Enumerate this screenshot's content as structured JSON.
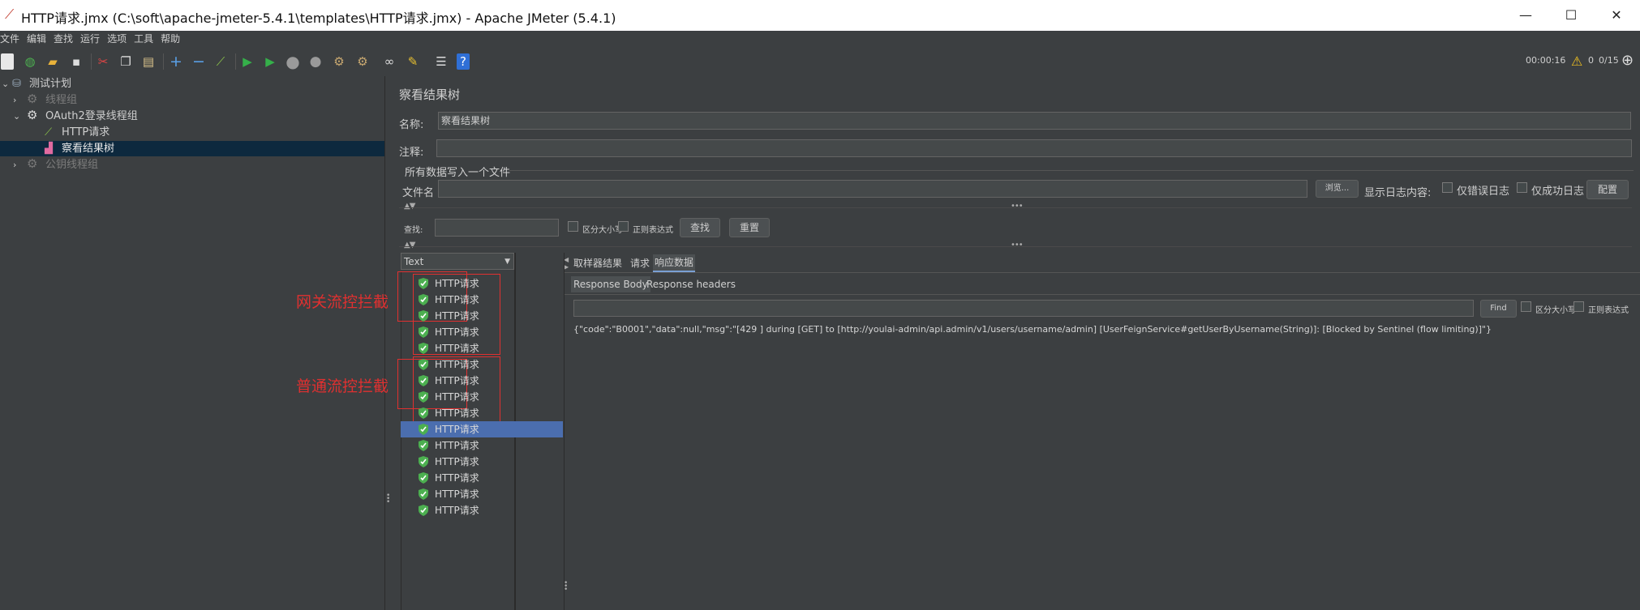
{
  "window": {
    "title": "HTTP请求.jmx (C:\\soft\\apache-jmeter-5.4.1\\templates\\HTTP请求.jmx) - Apache JMeter (5.4.1)",
    "minimize": "—",
    "maximize": "☐",
    "close": "✕"
  },
  "menu": [
    "文件",
    "编辑",
    "查找",
    "运行",
    "选项",
    "工具",
    "帮助"
  ],
  "toolbar_status": {
    "elapsed": "00:00:16",
    "warnings": "0",
    "threads": "0/15"
  },
  "tree": {
    "items": [
      {
        "label": "测试计划"
      },
      {
        "label": "线程组"
      },
      {
        "label": "OAuth2登录线程组"
      },
      {
        "label": "HTTP请求"
      },
      {
        "label": "察看结果树"
      },
      {
        "label": "公钥线程组"
      }
    ]
  },
  "panel": {
    "title": "察看结果树",
    "name_label": "名称:",
    "name_value": "察看结果树",
    "comment_label": "注释:",
    "comment_value": "",
    "file_section": "所有数据写入一个文件",
    "filename_label": "文件名",
    "filename_value": "",
    "browse": "浏览...",
    "log_label": "显示日志内容:",
    "errors_only": "仅错误日志",
    "success_only": "仅成功日志",
    "configure": "配置",
    "search_label": "查找:",
    "search_value": "",
    "case_sensitive": "区分大小写",
    "regex": "正则表达式",
    "find": "查找",
    "reset": "重置"
  },
  "results": {
    "renderer": "Text",
    "items": [
      "HTTP请求",
      "HTTP请求",
      "HTTP请求",
      "HTTP请求",
      "HTTP请求",
      "HTTP请求",
      "HTTP请求",
      "HTTP请求",
      "HTTP请求",
      "HTTP请求",
      "HTTP请求",
      "HTTP请求",
      "HTTP请求",
      "HTTP请求",
      "HTTP请求"
    ],
    "selected_index": 9,
    "annotations": {
      "gateway": "网关流控拦截",
      "normal": "普通流控拦截"
    }
  },
  "detail": {
    "tabs": [
      "取样器结果",
      "请求",
      "响应数据"
    ],
    "active_tab": "响应数据",
    "subtabs": [
      "Response Body",
      "Response headers"
    ],
    "find_button": "Find",
    "case_sensitive": "区分大小写",
    "regex": "正则表达式",
    "body": "{\"code\":\"B0001\",\"data\":null,\"msg\":\"[429 ] during [GET] to [http://youlai-admin/api.admin/v1/users/username/admin] [UserFeignService#getUserByUsername(String)]: [Blocked by Sentinel (flow limiting)]\"}"
  },
  "colors": {
    "background": "#3c3f41",
    "selection": "#4b6eaf",
    "annotation": "#e03030",
    "success": "#4caf50"
  }
}
